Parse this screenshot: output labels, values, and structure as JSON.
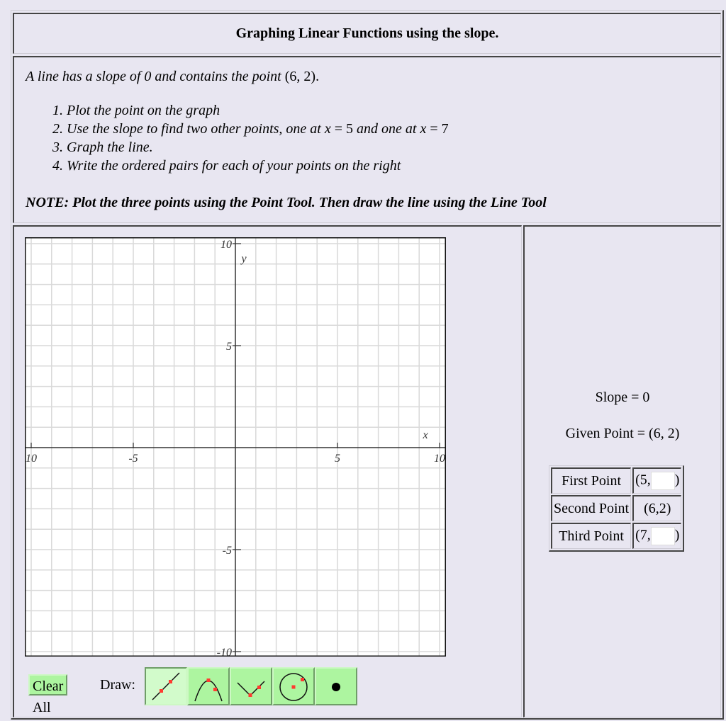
{
  "title": "Graphing Linear Functions using the slope.",
  "problem": {
    "prompt_text": "A line has a slope of 0 and contains the point",
    "prompt_point": "(6, 2)",
    "prompt_end": ".",
    "steps": [
      {
        "text": "Plot the point on the graph"
      },
      {
        "text": "Use the slope to find two other points, one at",
        "var1": "x",
        "eq1": " = 5",
        "mid": " and one at ",
        "var2": "x",
        "eq2": " = 7"
      },
      {
        "text": "Graph the line."
      },
      {
        "text": "Write the ordered pairs for each of your points on the right"
      }
    ],
    "note": "NOTE: Plot the three points using the Point Tool. Then draw the line using the Line Tool"
  },
  "graph": {
    "x_axis_label": "x",
    "y_axis_label": "y",
    "x_range": [
      -10,
      10
    ],
    "y_range": [
      -10,
      10
    ],
    "grid_step": 1,
    "x_tick_labels": [
      {
        "value": -10,
        "label": "10"
      },
      {
        "value": -5,
        "label": "-5"
      },
      {
        "value": 5,
        "label": "5"
      },
      {
        "value": 10,
        "label": "10"
      }
    ],
    "y_tick_labels": [
      {
        "value": 10,
        "label": "10"
      },
      {
        "value": 5,
        "label": "5"
      },
      {
        "value": -5,
        "label": "-5"
      },
      {
        "value": -10,
        "label": "-10"
      }
    ]
  },
  "toolbar": {
    "clear_label": "Clear All",
    "draw_label": "Draw:",
    "tools": [
      {
        "name": "line-tool",
        "selected": true
      },
      {
        "name": "parabola-tool",
        "selected": false
      },
      {
        "name": "absolute-value-tool",
        "selected": false
      },
      {
        "name": "circle-tool",
        "selected": false
      },
      {
        "name": "point-tool",
        "selected": false
      }
    ],
    "colors": {
      "button_bg": "#adf5a0",
      "selected_bg": "#d2fbcb",
      "handle": "#ff3b30"
    }
  },
  "side": {
    "slope_text": "Slope = 0",
    "given_text": "Given Point = (6, 2)",
    "points": [
      {
        "label": "First Point",
        "prefix": "(5,",
        "value": "",
        "suffix": ")",
        "editable": true
      },
      {
        "label": "Second Point",
        "fixed": "(6,2)",
        "editable": false
      },
      {
        "label": "Third Point",
        "prefix": "(7,",
        "value": "",
        "suffix": ")",
        "editable": true
      }
    ]
  }
}
